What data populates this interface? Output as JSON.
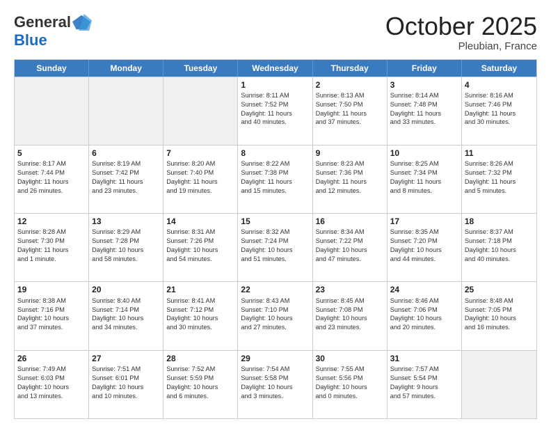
{
  "header": {
    "logo_line1": "General",
    "logo_line2": "Blue",
    "month": "October 2025",
    "location": "Pleubian, France"
  },
  "days_of_week": [
    "Sunday",
    "Monday",
    "Tuesday",
    "Wednesday",
    "Thursday",
    "Friday",
    "Saturday"
  ],
  "weeks": [
    [
      {
        "day": "",
        "text": "",
        "shaded": true
      },
      {
        "day": "",
        "text": "",
        "shaded": true
      },
      {
        "day": "",
        "text": "",
        "shaded": true
      },
      {
        "day": "1",
        "text": "Sunrise: 8:11 AM\nSunset: 7:52 PM\nDaylight: 11 hours\nand 40 minutes.",
        "shaded": false
      },
      {
        "day": "2",
        "text": "Sunrise: 8:13 AM\nSunset: 7:50 PM\nDaylight: 11 hours\nand 37 minutes.",
        "shaded": false
      },
      {
        "day": "3",
        "text": "Sunrise: 8:14 AM\nSunset: 7:48 PM\nDaylight: 11 hours\nand 33 minutes.",
        "shaded": false
      },
      {
        "day": "4",
        "text": "Sunrise: 8:16 AM\nSunset: 7:46 PM\nDaylight: 11 hours\nand 30 minutes.",
        "shaded": false
      }
    ],
    [
      {
        "day": "5",
        "text": "Sunrise: 8:17 AM\nSunset: 7:44 PM\nDaylight: 11 hours\nand 26 minutes.",
        "shaded": false
      },
      {
        "day": "6",
        "text": "Sunrise: 8:19 AM\nSunset: 7:42 PM\nDaylight: 11 hours\nand 23 minutes.",
        "shaded": false
      },
      {
        "day": "7",
        "text": "Sunrise: 8:20 AM\nSunset: 7:40 PM\nDaylight: 11 hours\nand 19 minutes.",
        "shaded": false
      },
      {
        "day": "8",
        "text": "Sunrise: 8:22 AM\nSunset: 7:38 PM\nDaylight: 11 hours\nand 15 minutes.",
        "shaded": false
      },
      {
        "day": "9",
        "text": "Sunrise: 8:23 AM\nSunset: 7:36 PM\nDaylight: 11 hours\nand 12 minutes.",
        "shaded": false
      },
      {
        "day": "10",
        "text": "Sunrise: 8:25 AM\nSunset: 7:34 PM\nDaylight: 11 hours\nand 8 minutes.",
        "shaded": false
      },
      {
        "day": "11",
        "text": "Sunrise: 8:26 AM\nSunset: 7:32 PM\nDaylight: 11 hours\nand 5 minutes.",
        "shaded": false
      }
    ],
    [
      {
        "day": "12",
        "text": "Sunrise: 8:28 AM\nSunset: 7:30 PM\nDaylight: 11 hours\nand 1 minute.",
        "shaded": false
      },
      {
        "day": "13",
        "text": "Sunrise: 8:29 AM\nSunset: 7:28 PM\nDaylight: 10 hours\nand 58 minutes.",
        "shaded": false
      },
      {
        "day": "14",
        "text": "Sunrise: 8:31 AM\nSunset: 7:26 PM\nDaylight: 10 hours\nand 54 minutes.",
        "shaded": false
      },
      {
        "day": "15",
        "text": "Sunrise: 8:32 AM\nSunset: 7:24 PM\nDaylight: 10 hours\nand 51 minutes.",
        "shaded": false
      },
      {
        "day": "16",
        "text": "Sunrise: 8:34 AM\nSunset: 7:22 PM\nDaylight: 10 hours\nand 47 minutes.",
        "shaded": false
      },
      {
        "day": "17",
        "text": "Sunrise: 8:35 AM\nSunset: 7:20 PM\nDaylight: 10 hours\nand 44 minutes.",
        "shaded": false
      },
      {
        "day": "18",
        "text": "Sunrise: 8:37 AM\nSunset: 7:18 PM\nDaylight: 10 hours\nand 40 minutes.",
        "shaded": false
      }
    ],
    [
      {
        "day": "19",
        "text": "Sunrise: 8:38 AM\nSunset: 7:16 PM\nDaylight: 10 hours\nand 37 minutes.",
        "shaded": false
      },
      {
        "day": "20",
        "text": "Sunrise: 8:40 AM\nSunset: 7:14 PM\nDaylight: 10 hours\nand 34 minutes.",
        "shaded": false
      },
      {
        "day": "21",
        "text": "Sunrise: 8:41 AM\nSunset: 7:12 PM\nDaylight: 10 hours\nand 30 minutes.",
        "shaded": false
      },
      {
        "day": "22",
        "text": "Sunrise: 8:43 AM\nSunset: 7:10 PM\nDaylight: 10 hours\nand 27 minutes.",
        "shaded": false
      },
      {
        "day": "23",
        "text": "Sunrise: 8:45 AM\nSunset: 7:08 PM\nDaylight: 10 hours\nand 23 minutes.",
        "shaded": false
      },
      {
        "day": "24",
        "text": "Sunrise: 8:46 AM\nSunset: 7:06 PM\nDaylight: 10 hours\nand 20 minutes.",
        "shaded": false
      },
      {
        "day": "25",
        "text": "Sunrise: 8:48 AM\nSunset: 7:05 PM\nDaylight: 10 hours\nand 16 minutes.",
        "shaded": false
      }
    ],
    [
      {
        "day": "26",
        "text": "Sunrise: 7:49 AM\nSunset: 6:03 PM\nDaylight: 10 hours\nand 13 minutes.",
        "shaded": false
      },
      {
        "day": "27",
        "text": "Sunrise: 7:51 AM\nSunset: 6:01 PM\nDaylight: 10 hours\nand 10 minutes.",
        "shaded": false
      },
      {
        "day": "28",
        "text": "Sunrise: 7:52 AM\nSunset: 5:59 PM\nDaylight: 10 hours\nand 6 minutes.",
        "shaded": false
      },
      {
        "day": "29",
        "text": "Sunrise: 7:54 AM\nSunset: 5:58 PM\nDaylight: 10 hours\nand 3 minutes.",
        "shaded": false
      },
      {
        "day": "30",
        "text": "Sunrise: 7:55 AM\nSunset: 5:56 PM\nDaylight: 10 hours\nand 0 minutes.",
        "shaded": false
      },
      {
        "day": "31",
        "text": "Sunrise: 7:57 AM\nSunset: 5:54 PM\nDaylight: 9 hours\nand 57 minutes.",
        "shaded": false
      },
      {
        "day": "",
        "text": "",
        "shaded": true
      }
    ]
  ]
}
